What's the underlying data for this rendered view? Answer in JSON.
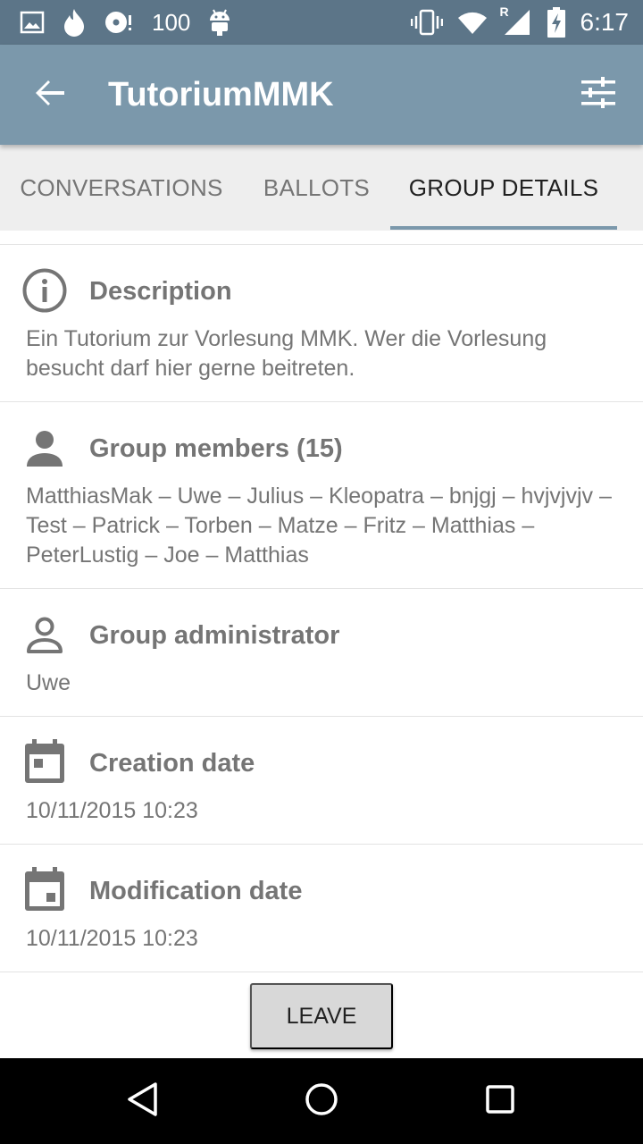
{
  "status_bar": {
    "battery_level": "100",
    "time": "6:17",
    "network_indicator": "R",
    "icons": [
      "image-icon",
      "flame-icon",
      "disc-icon",
      "android-icon",
      "vibrate-icon",
      "wifi-icon",
      "signal-icon",
      "battery-charging-icon"
    ]
  },
  "app_bar": {
    "title": "TutoriumMMK",
    "back_icon": "arrow-back-icon",
    "settings_icon": "tune-icon",
    "color": "#7b98ab"
  },
  "tabs": [
    {
      "label": "CONVERSATIONS",
      "active": false
    },
    {
      "label": "BALLOTS",
      "active": false
    },
    {
      "label": "GROUP DETAILS",
      "active": true
    }
  ],
  "sections": {
    "description": {
      "title": "Description",
      "body": "Ein Tutorium zur Vorlesung MMK. Wer die Vorlesung besucht darf hier gerne beitreten.",
      "icon": "info-icon"
    },
    "members": {
      "title": "Group members (15)",
      "body": "MatthiasMak – Uwe – Julius – Kleopatra – bnjgj – hvjvjvjv – Test – Patrick – Torben – Matze – Fritz – Matthias – PeterLustig – Joe – Matthias",
      "icon": "person-icon"
    },
    "administrator": {
      "title": "Group administrator",
      "body": "Uwe",
      "icon": "person-outline-icon"
    },
    "creation": {
      "title": "Creation date",
      "body": "10/11/2015 10:23",
      "icon": "calendar-icon"
    },
    "modification": {
      "title": "Modification date",
      "body": "10/11/2015 10:23",
      "icon": "calendar-event-icon"
    }
  },
  "leave_button": {
    "label": "LEAVE"
  },
  "nav_bar": {
    "icons": [
      "back-triangle-icon",
      "home-circle-icon",
      "recents-square-icon"
    ]
  }
}
